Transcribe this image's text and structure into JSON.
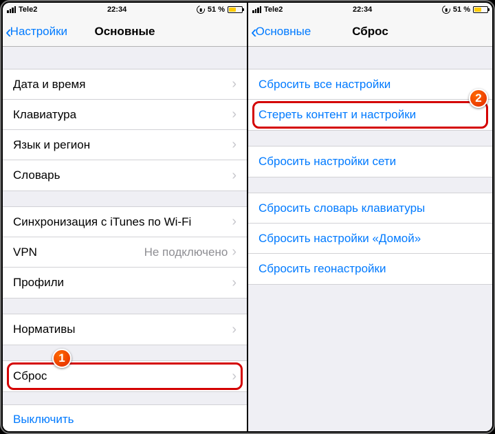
{
  "status": {
    "carrier": "Tele2",
    "time": "22:34",
    "battery_pct": "51 %"
  },
  "left": {
    "back_label": "Настройки",
    "title": "Основные",
    "groups": [
      {
        "id": "g1",
        "rows": [
          {
            "label": "Дата и время",
            "value": "",
            "link": false,
            "disclosure": true,
            "name": "row-date-time"
          },
          {
            "label": "Клавиатура",
            "value": "",
            "link": false,
            "disclosure": true,
            "name": "row-keyboard"
          },
          {
            "label": "Язык и регион",
            "value": "",
            "link": false,
            "disclosure": true,
            "name": "row-language-region"
          },
          {
            "label": "Словарь",
            "value": "",
            "link": false,
            "disclosure": true,
            "name": "row-dictionary"
          }
        ]
      },
      {
        "id": "g2",
        "rows": [
          {
            "label": "Синхронизация с iTunes по Wi-Fi",
            "value": "",
            "link": false,
            "disclosure": true,
            "name": "row-itunes-wifi"
          },
          {
            "label": "VPN",
            "value": "Не подключено",
            "link": false,
            "disclosure": true,
            "name": "row-vpn"
          },
          {
            "label": "Профили",
            "value": "",
            "link": false,
            "disclosure": true,
            "name": "row-profiles"
          }
        ]
      },
      {
        "id": "g3",
        "rows": [
          {
            "label": "Нормативы",
            "value": "",
            "link": false,
            "disclosure": true,
            "name": "row-regulatory"
          }
        ]
      },
      {
        "id": "g4",
        "rows": [
          {
            "label": "Сброс",
            "value": "",
            "link": false,
            "disclosure": true,
            "name": "row-reset",
            "annotate": 1
          }
        ]
      }
    ],
    "shutdown_label": "Выключить"
  },
  "right": {
    "back_label": "Основные",
    "title": "Сброс",
    "groups": [
      {
        "id": "r1",
        "rows": [
          {
            "label": "Сбросить все настройки",
            "link": true,
            "name": "row-reset-all"
          },
          {
            "label": "Стереть контент и настройки",
            "link": true,
            "name": "row-erase-all",
            "annotate": 2
          }
        ]
      },
      {
        "id": "r2",
        "rows": [
          {
            "label": "Сбросить настройки сети",
            "link": true,
            "name": "row-reset-network"
          }
        ]
      },
      {
        "id": "r3",
        "rows": [
          {
            "label": "Сбросить словарь клавиатуры",
            "link": true,
            "name": "row-reset-keyboard-dict"
          },
          {
            "label": "Сбросить настройки «Домой»",
            "link": true,
            "name": "row-reset-home"
          },
          {
            "label": "Сбросить геонастройки",
            "link": true,
            "name": "row-reset-location"
          }
        ]
      }
    ]
  },
  "annotations": {
    "1": "1",
    "2": "2"
  }
}
